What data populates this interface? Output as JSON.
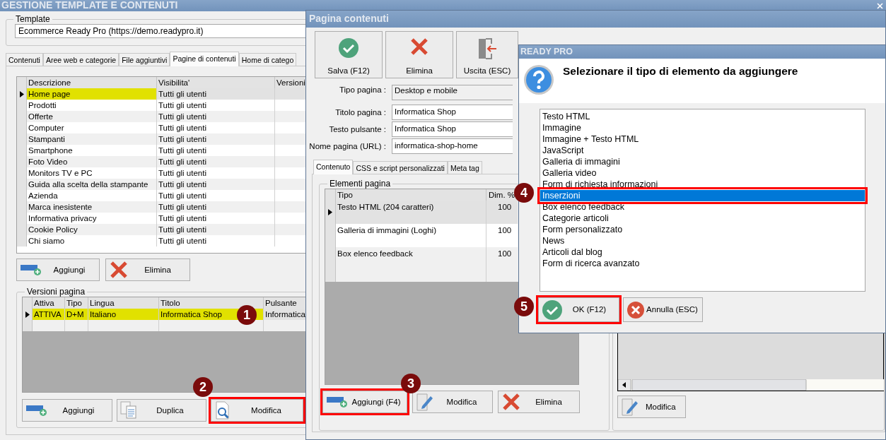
{
  "main_window": {
    "title": "GESTIONE TEMPLATE E CONTENUTI",
    "template": {
      "legend": "Template",
      "value": "Ecommerce Ready Pro (https://demo.readypro.it)"
    },
    "tabs": [
      {
        "label": "Contenuti",
        "selected": false
      },
      {
        "label": "Aree web e categorie",
        "selected": false
      },
      {
        "label": "File aggiuntivi",
        "selected": false
      },
      {
        "label": "Pagine di contenuti",
        "selected": true
      },
      {
        "label": "Home di catego",
        "selected": false
      }
    ],
    "pages_table": {
      "columns": [
        "Descrizione",
        "Visibilita'",
        "Versioni"
      ],
      "rows": [
        {
          "cells": [
            "Home page",
            "Tutti gli utenti"
          ],
          "selected": true
        },
        {
          "cells": [
            "Prodotti",
            "Tutti gli utenti"
          ],
          "selected": false
        },
        {
          "cells": [
            "Offerte",
            "Tutti gli utenti"
          ],
          "selected": false
        },
        {
          "cells": [
            "Computer",
            "Tutti gli utenti"
          ],
          "selected": false
        },
        {
          "cells": [
            "Stampanti",
            "Tutti gli utenti"
          ],
          "selected": false
        },
        {
          "cells": [
            "Smartphone",
            "Tutti gli utenti"
          ],
          "selected": false
        },
        {
          "cells": [
            "Foto Video",
            "Tutti gli utenti"
          ],
          "selected": false
        },
        {
          "cells": [
            "Monitors TV e PC",
            "Tutti gli utenti"
          ],
          "selected": false
        },
        {
          "cells": [
            "Guida alla scelta della stampante",
            "Tutti gli utenti"
          ],
          "selected": false
        },
        {
          "cells": [
            "Azienda",
            "Tutti gli utenti"
          ],
          "selected": false
        },
        {
          "cells": [
            "Marca inesistente",
            "Tutti gli utenti"
          ],
          "selected": false
        },
        {
          "cells": [
            "Informativa privacy",
            "Tutti gli utenti"
          ],
          "selected": false
        },
        {
          "cells": [
            "Cookie Policy",
            "Tutti gli utenti"
          ],
          "selected": false
        },
        {
          "cells": [
            "Chi siamo",
            "Tutti gli utenti"
          ],
          "selected": false
        }
      ]
    },
    "page_buttons": [
      {
        "label": "Aggiungi",
        "kind": "add",
        "highlighted": false
      },
      {
        "label": "Elimina",
        "kind": "delete",
        "highlighted": false
      }
    ],
    "versions": {
      "legend": "Versioni pagina",
      "columns": [
        "Attiva",
        "Tipo",
        "Lingua",
        "Titolo",
        "Pulsante"
      ],
      "rows": [
        {
          "cells": [
            "ATTIVA",
            "D+M",
            "Italiano",
            "Informatica Shop",
            "Informatica"
          ],
          "selected": true
        }
      ],
      "buttons": [
        {
          "label": "Aggiungi",
          "kind": "add",
          "highlighted": false
        },
        {
          "label": "Duplica",
          "kind": "duplicate",
          "highlighted": false
        },
        {
          "label": "Modifica",
          "kind": "inspect",
          "highlighted": true
        }
      ]
    }
  },
  "content_window": {
    "title": "Pagina contenuti",
    "toolbar": [
      {
        "label": "Salva (F12)",
        "kind": "ok"
      },
      {
        "label": "Elimina",
        "kind": "delete"
      },
      {
        "label": "Uscita (ESC)",
        "kind": "exit"
      }
    ],
    "fields": [
      {
        "label": "Tipo pagina :",
        "value": "Desktop e mobile",
        "readonly": true
      },
      {
        "label": "Titolo pagina :",
        "value": "Informatica Shop",
        "readonly": false
      },
      {
        "label": "Testo pulsante :",
        "value": "Informatica Shop",
        "readonly": false
      },
      {
        "label": "Nome pagina (URL) :",
        "value": "informatica-shop-home",
        "readonly": false
      }
    ],
    "tabs": [
      {
        "label": "Contenuto",
        "selected": true
      },
      {
        "label": "CSS e script personalizzati",
        "selected": false
      },
      {
        "label": "Meta tag",
        "selected": false
      }
    ],
    "elements": {
      "legend": "Elementi pagina",
      "columns": [
        "Tipo",
        "Dim. %"
      ],
      "rows": [
        {
          "cells": [
            "Testo HTML (204 caratteri)",
            "100"
          ],
          "selected": true
        },
        {
          "cells": [
            "Galleria di immagini (Loghi)",
            "100"
          ],
          "selected": false
        },
        {
          "cells": [
            "Box elenco feedback",
            "100"
          ],
          "selected": false
        }
      ],
      "buttons": [
        {
          "label": "Aggiungi (F4)",
          "kind": "add",
          "highlighted": true
        },
        {
          "label": "Modifica",
          "kind": "edit",
          "highlighted": false
        },
        {
          "label": "Elimina",
          "kind": "delete",
          "highlighted": false
        }
      ]
    },
    "side_buttons": [
      {
        "label": "Modifica",
        "kind": "edit",
        "highlighted": false
      }
    ]
  },
  "dialog": {
    "title": "READY PRO",
    "message": "Selezionare il tipo di elemento da aggiungere",
    "items": [
      {
        "label": "Testo HTML",
        "selected": false,
        "highlighted": false
      },
      {
        "label": "Immagine",
        "selected": false,
        "highlighted": false
      },
      {
        "label": "Immagine + Testo HTML",
        "selected": false,
        "highlighted": false
      },
      {
        "label": "JavaScript",
        "selected": false,
        "highlighted": false
      },
      {
        "label": "Galleria di immagini",
        "selected": false,
        "highlighted": false
      },
      {
        "label": "Galleria video",
        "selected": false,
        "highlighted": false
      },
      {
        "label": "Form di richiesta informazioni",
        "selected": false,
        "highlighted": false
      },
      {
        "label": "Inserzioni",
        "selected": true,
        "highlighted": true
      },
      {
        "label": "Box elenco feedback",
        "selected": false,
        "highlighted": false
      },
      {
        "label": "Categorie articoli",
        "selected": false,
        "highlighted": false
      },
      {
        "label": "Form personalizzato",
        "selected": false,
        "highlighted": false
      },
      {
        "label": "News",
        "selected": false,
        "highlighted": false
      },
      {
        "label": "Articoli dal blog",
        "selected": false,
        "highlighted": false
      },
      {
        "label": "Form di ricerca avanzato",
        "selected": false,
        "highlighted": false
      }
    ],
    "buttons": [
      {
        "label": "OK (F12)",
        "kind": "ok",
        "highlighted": true
      },
      {
        "label": "Annulla (ESC)",
        "kind": "cancel",
        "highlighted": false
      }
    ]
  },
  "callouts": [
    "1",
    "2",
    "3",
    "4",
    "5"
  ]
}
